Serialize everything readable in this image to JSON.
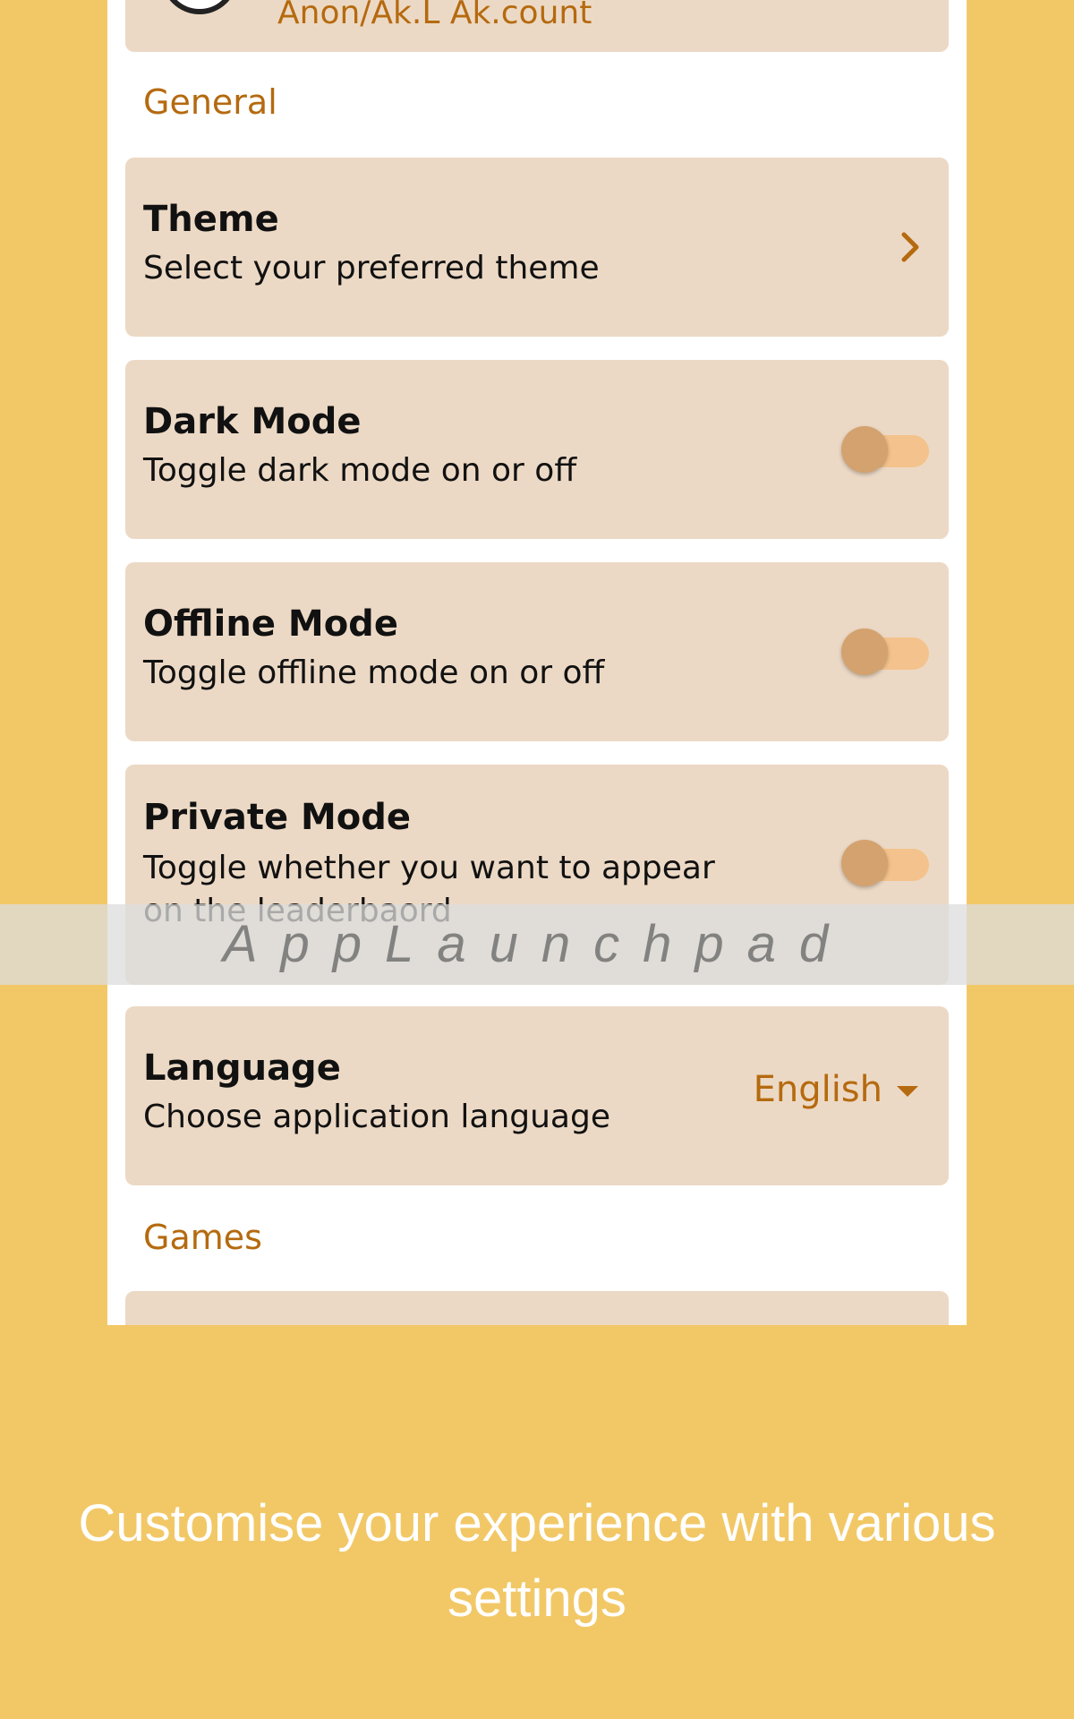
{
  "account": {
    "label": "Anon/Ak.L Ak.count"
  },
  "sections": {
    "general": "General",
    "games": "Games"
  },
  "settings": {
    "theme": {
      "title": "Theme",
      "subtitle": "Select your preferred theme"
    },
    "dark_mode": {
      "title": "Dark Mode",
      "subtitle": "Toggle dark mode on or off",
      "enabled": false
    },
    "offline_mode": {
      "title": "Offline Mode",
      "subtitle": "Toggle offline mode on or off",
      "enabled": false
    },
    "private_mode": {
      "title": "Private Mode",
      "subtitle": "Toggle whether you want to appear on the leaderbaord",
      "enabled": false
    },
    "language": {
      "title": "Language",
      "subtitle": "Choose application language",
      "value": "English"
    }
  },
  "watermark": "AppLaunchpad",
  "caption": "Customise your experience with various settings",
  "colors": {
    "background": "#F2C867",
    "card": "#ECD9C5",
    "accent": "#B56A0F",
    "toggle_track": "#F4C28C",
    "toggle_thumb": "#D4A26F"
  },
  "icons": {
    "theme_action": "chevron-right-icon",
    "language_action": "caret-down-icon",
    "account": "avatar-icon"
  }
}
